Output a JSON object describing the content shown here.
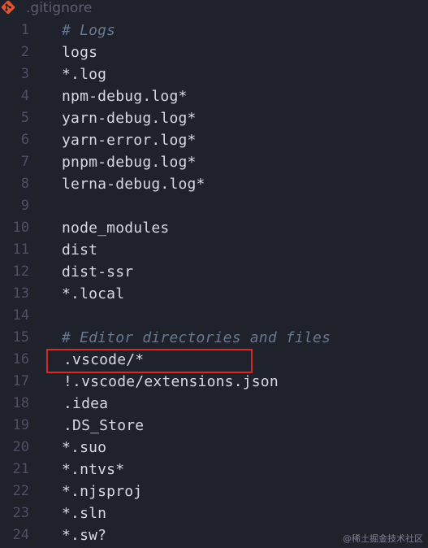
{
  "file": {
    "name": ".gitignore",
    "icon": "git-icon",
    "icon_color": "#e4552f"
  },
  "lines": [
    {
      "number": "1",
      "text": "# Logs",
      "kind": "comment"
    },
    {
      "number": "2",
      "text": "logs",
      "kind": "code"
    },
    {
      "number": "3",
      "text": "*.log",
      "kind": "code"
    },
    {
      "number": "4",
      "text": "npm-debug.log*",
      "kind": "code"
    },
    {
      "number": "5",
      "text": "yarn-debug.log*",
      "kind": "code"
    },
    {
      "number": "6",
      "text": "yarn-error.log*",
      "kind": "code"
    },
    {
      "number": "7",
      "text": "pnpm-debug.log*",
      "kind": "code"
    },
    {
      "number": "8",
      "text": "lerna-debug.log*",
      "kind": "code"
    },
    {
      "number": "9",
      "text": "",
      "kind": "code"
    },
    {
      "number": "10",
      "text": "node_modules",
      "kind": "code"
    },
    {
      "number": "11",
      "text": "dist",
      "kind": "code"
    },
    {
      "number": "12",
      "text": "dist-ssr",
      "kind": "code"
    },
    {
      "number": "13",
      "text": "*.local",
      "kind": "code"
    },
    {
      "number": "14",
      "text": "",
      "kind": "code"
    },
    {
      "number": "15",
      "text": "# Editor directories and files",
      "kind": "comment"
    },
    {
      "number": "16",
      "text": ".vscode/*",
      "kind": "code"
    },
    {
      "number": "17",
      "text": "!.vscode/extensions.json",
      "kind": "code"
    },
    {
      "number": "18",
      "text": ".idea",
      "kind": "code"
    },
    {
      "number": "19",
      "text": ".DS_Store",
      "kind": "code"
    },
    {
      "number": "20",
      "text": "*.suo",
      "kind": "code"
    },
    {
      "number": "21",
      "text": "*.ntvs*",
      "kind": "code"
    },
    {
      "number": "22",
      "text": "*.njsproj",
      "kind": "code"
    },
    {
      "number": "23",
      "text": "*.sln",
      "kind": "code"
    },
    {
      "number": "24",
      "text": "*.sw?",
      "kind": "code"
    }
  ],
  "highlighted_line": "16",
  "highlight_color": "#d42a2a",
  "watermark": "@稀土掘金技术社区"
}
